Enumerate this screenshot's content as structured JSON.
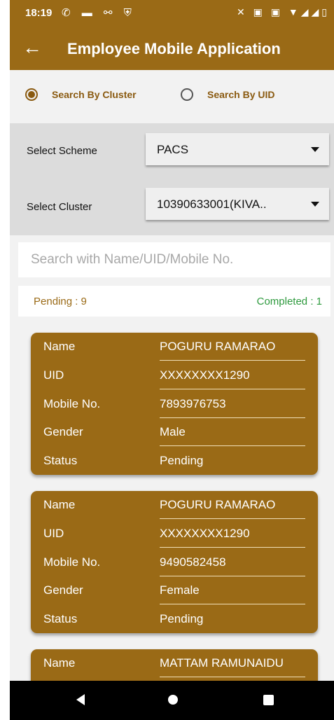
{
  "statusbar": {
    "time": "18:19",
    "left_icons": "✆ ▬ ⚯ ⛨",
    "right_icons": "✕ ▣ ▣ ▼◢◢▯"
  },
  "header": {
    "back_icon": "arrow-left-icon",
    "title": "Employee Mobile Application"
  },
  "search_mode": {
    "options": [
      {
        "label": "Search By Cluster",
        "selected": true
      },
      {
        "label": "Search By UID",
        "selected": false
      }
    ]
  },
  "filters": {
    "scheme": {
      "label": "Select Scheme",
      "value": "PACS"
    },
    "cluster": {
      "label": "Select Cluster",
      "value": "10390633001(KIVA.."
    }
  },
  "search": {
    "placeholder": "Search with Name/UID/Mobile No.",
    "value": ""
  },
  "counts": {
    "pending": "Pending : 9",
    "completed": "Completed : 1"
  },
  "field_labels": {
    "name": "Name",
    "uid": "UID",
    "mobile": "Mobile No.",
    "gender": "Gender",
    "status": "Status"
  },
  "records": [
    {
      "name": "POGURU RAMARAO",
      "uid": "XXXXXXXX1290",
      "mobile": "7893976753",
      "gender": "Male",
      "status": "Pending"
    },
    {
      "name": "POGURU RAMARAO",
      "uid": "XXXXXXXX1290",
      "mobile": "9490582458",
      "gender": "Female",
      "status": "Pending"
    },
    {
      "name": "MATTAM RAMUNAIDU"
    }
  ],
  "colors": {
    "primary": "#9a6a16",
    "completed": "#2e9a3e",
    "filter_bg": "#dcdcdc"
  }
}
